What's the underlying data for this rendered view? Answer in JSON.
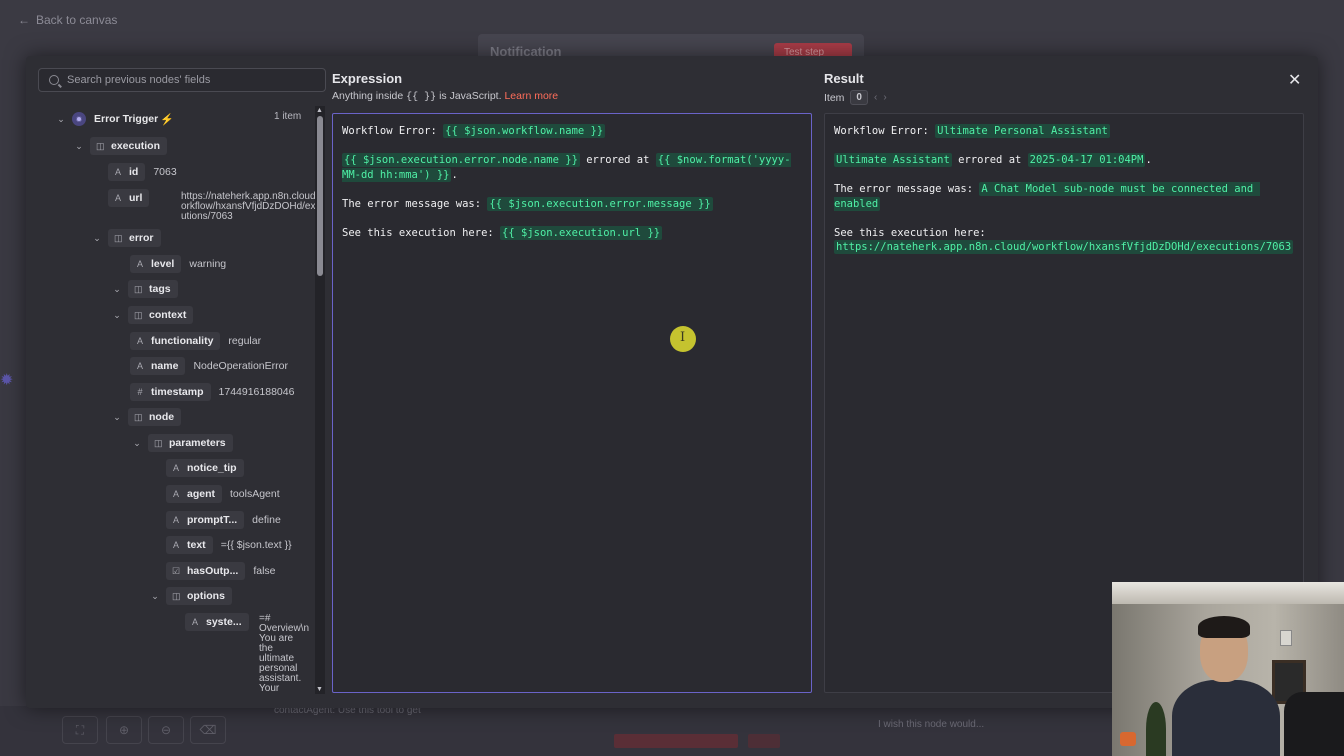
{
  "background": {
    "back_link": "Back to canvas",
    "node_title": "Notification",
    "test_step": "Test step",
    "contact_agent_hint": "contactAgent: Use this tool to get",
    "wish_text": "I wish this node would..."
  },
  "search": {
    "placeholder": "Search previous nodes' fields"
  },
  "tree": {
    "root": {
      "label": "Error Trigger",
      "count": "1 item"
    },
    "execution": "execution",
    "id": {
      "key": "id",
      "value": "7063"
    },
    "url": {
      "key": "url",
      "value": "https://nateherk.app.n8n.cloud/workflow/hxansfVfjdDzDOHd/executions/7063"
    },
    "error": "error",
    "level": {
      "key": "level",
      "value": "warning"
    },
    "tags": "tags",
    "context": "context",
    "functionality": {
      "key": "functionality",
      "value": "regular"
    },
    "name": {
      "key": "name",
      "value": "NodeOperationError"
    },
    "timestamp": {
      "key": "timestamp",
      "value": "1744916188046"
    },
    "node": "node",
    "parameters": "parameters",
    "notice_tip": {
      "key": "notice_tip",
      "value": ""
    },
    "agent": {
      "key": "agent",
      "value": "toolsAgent"
    },
    "promptType": {
      "key": "promptT...",
      "value": "define"
    },
    "text": {
      "key": "text",
      "value": "={{ $json.text }}"
    },
    "hasOutput": {
      "key": "hasOutp...",
      "value": "false"
    },
    "options": "options",
    "system": {
      "key": "syste...",
      "value": "=# Overview\\n You are the ultimate personal assistant. Your"
    }
  },
  "expression": {
    "title": "Expression",
    "subtitle_prefix": "Anything inside",
    "subtitle_code": "{{ }}",
    "subtitle_suffix": "is JavaScript.",
    "learn_more": "Learn more",
    "line1_text": "Workflow Error: ",
    "line1_expr": "{{ $json.workflow.name }}",
    "line2_expr": "{{ $json.execution.error.node.name }}",
    "line2_text": " errored at ",
    "line2_expr2": "{{ $now.format('yyyy-MM-dd hh:mma') }}",
    "line2_end": ".",
    "line3_text": "The error message was: ",
    "line3_expr": "{{ $json.execution.error.message }}",
    "line4_text": "See this execution here: ",
    "line4_expr": "{{ $json.execution.url }}"
  },
  "result": {
    "title": "Result",
    "item_label": "Item",
    "item_index": "0",
    "line1_text": "Workflow Error: ",
    "line1_val": "Ultimate Personal Assistant",
    "line2_val": "Ultimate Assistant",
    "line2_text": " errored at ",
    "line2_val2": "2025-04-17 01:04PM",
    "line2_end": ".",
    "line3_text": "The error message was: ",
    "line3_val": "A Chat Model sub-node must be connected and enabled",
    "line4_text": "See this execution here:",
    "line4_val": "https://nateherk.app.n8n.cloud/workflow/hxansfVfjdDzDOHd/executions/7063"
  },
  "icons": {
    "back": "arrow-left-icon",
    "search": "search-icon",
    "close": "close-icon",
    "trigger": "bug-icon",
    "bolt": "lightning-icon"
  },
  "colors": {
    "accent": "#ff6d5a",
    "highlight_bg": "#1f4a3c",
    "highlight_fg": "#4ff0a6",
    "editor_border": "#6a63c8"
  }
}
